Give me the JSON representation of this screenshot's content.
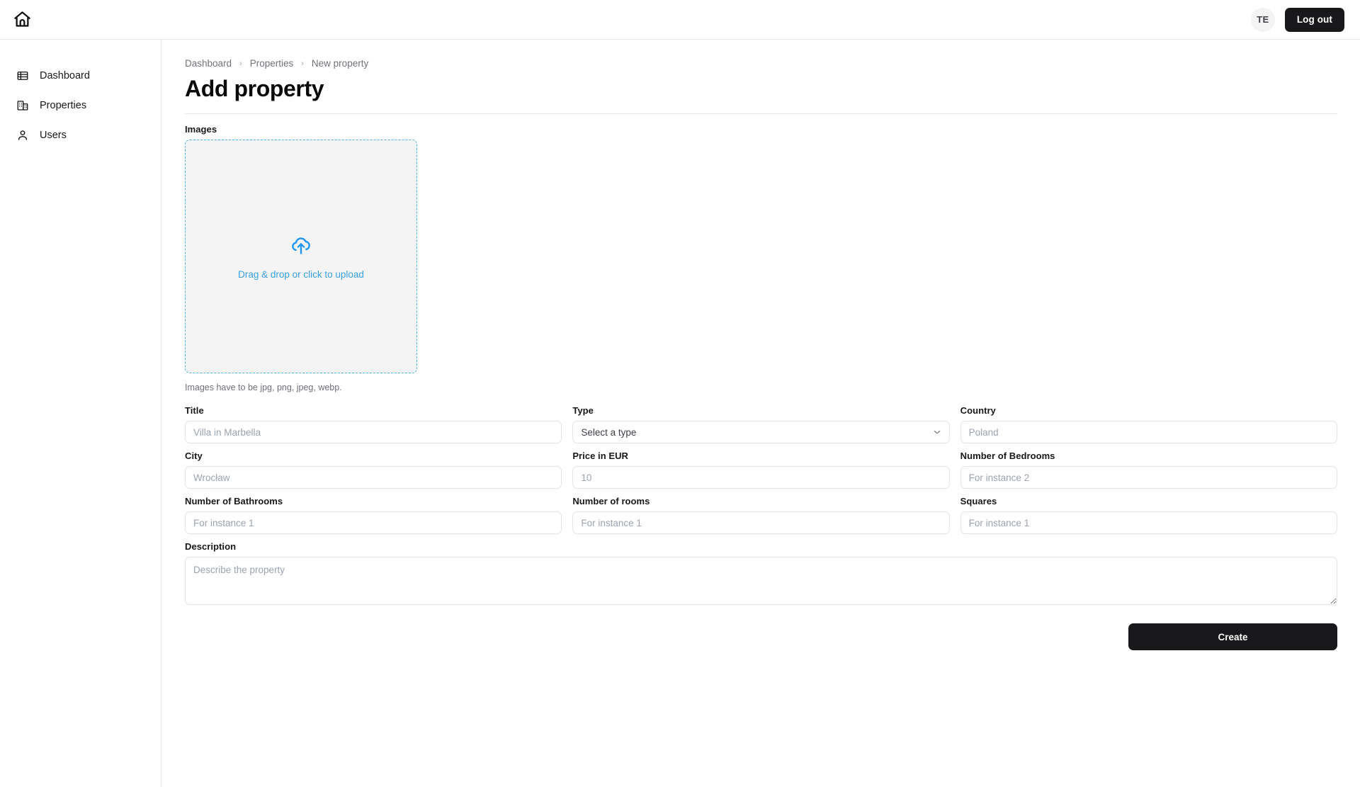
{
  "topbar": {
    "logo_icon": "home-icon",
    "avatar_initials": "TE",
    "logout_label": "Log out"
  },
  "sidebar": {
    "items": [
      {
        "label": "Dashboard",
        "icon": "table-grid-icon"
      },
      {
        "label": "Properties",
        "icon": "building-icon"
      },
      {
        "label": "Users",
        "icon": "user-icon"
      }
    ]
  },
  "breadcrumb": {
    "items": [
      "Dashboard",
      "Properties",
      "New property"
    ],
    "separator": "›"
  },
  "page": {
    "title": "Add property"
  },
  "images": {
    "label": "Images",
    "dropzone_icon": "cloud-upload-icon",
    "dropzone_text": "Drag & drop or click to upload",
    "hint": "Images have to be jpg, png, jpeg, webp."
  },
  "form": {
    "fields": [
      {
        "name": "title",
        "label": "Title",
        "type": "text",
        "value": "",
        "placeholder": "Villa in Marbella"
      },
      {
        "name": "type",
        "label": "Type",
        "type": "select",
        "value": "Select a type",
        "options": [
          "Select a type"
        ],
        "chevron_icon": "chevron-down-icon"
      },
      {
        "name": "country",
        "label": "Country",
        "type": "text",
        "value": "",
        "placeholder": "Poland"
      },
      {
        "name": "city",
        "label": "City",
        "type": "text",
        "value": "",
        "placeholder": "Wrocław"
      },
      {
        "name": "price",
        "label": "Price in EUR",
        "type": "text",
        "value": "",
        "placeholder": "10"
      },
      {
        "name": "bedrooms",
        "label": "Number of Bedrooms",
        "type": "text",
        "value": "",
        "placeholder": "For instance 2"
      },
      {
        "name": "bathrooms",
        "label": "Number of Bathrooms",
        "type": "text",
        "value": "",
        "placeholder": "For instance 1"
      },
      {
        "name": "rooms",
        "label": "Number of rooms",
        "type": "text",
        "value": "",
        "placeholder": "For instance 1"
      },
      {
        "name": "squares",
        "label": "Squares",
        "type": "text",
        "value": "",
        "placeholder": "For instance 1"
      }
    ],
    "description": {
      "label": "Description",
      "value": "",
      "placeholder": "Describe the property"
    },
    "submit_label": "Create"
  },
  "colors": {
    "accent_blue": "#3aa0dd",
    "dropzone_border": "#4eb3e8",
    "dropzone_bg": "#f4f4f5",
    "button_dark": "#18181b",
    "border": "#e5e7eb",
    "muted_text": "#71717a"
  }
}
